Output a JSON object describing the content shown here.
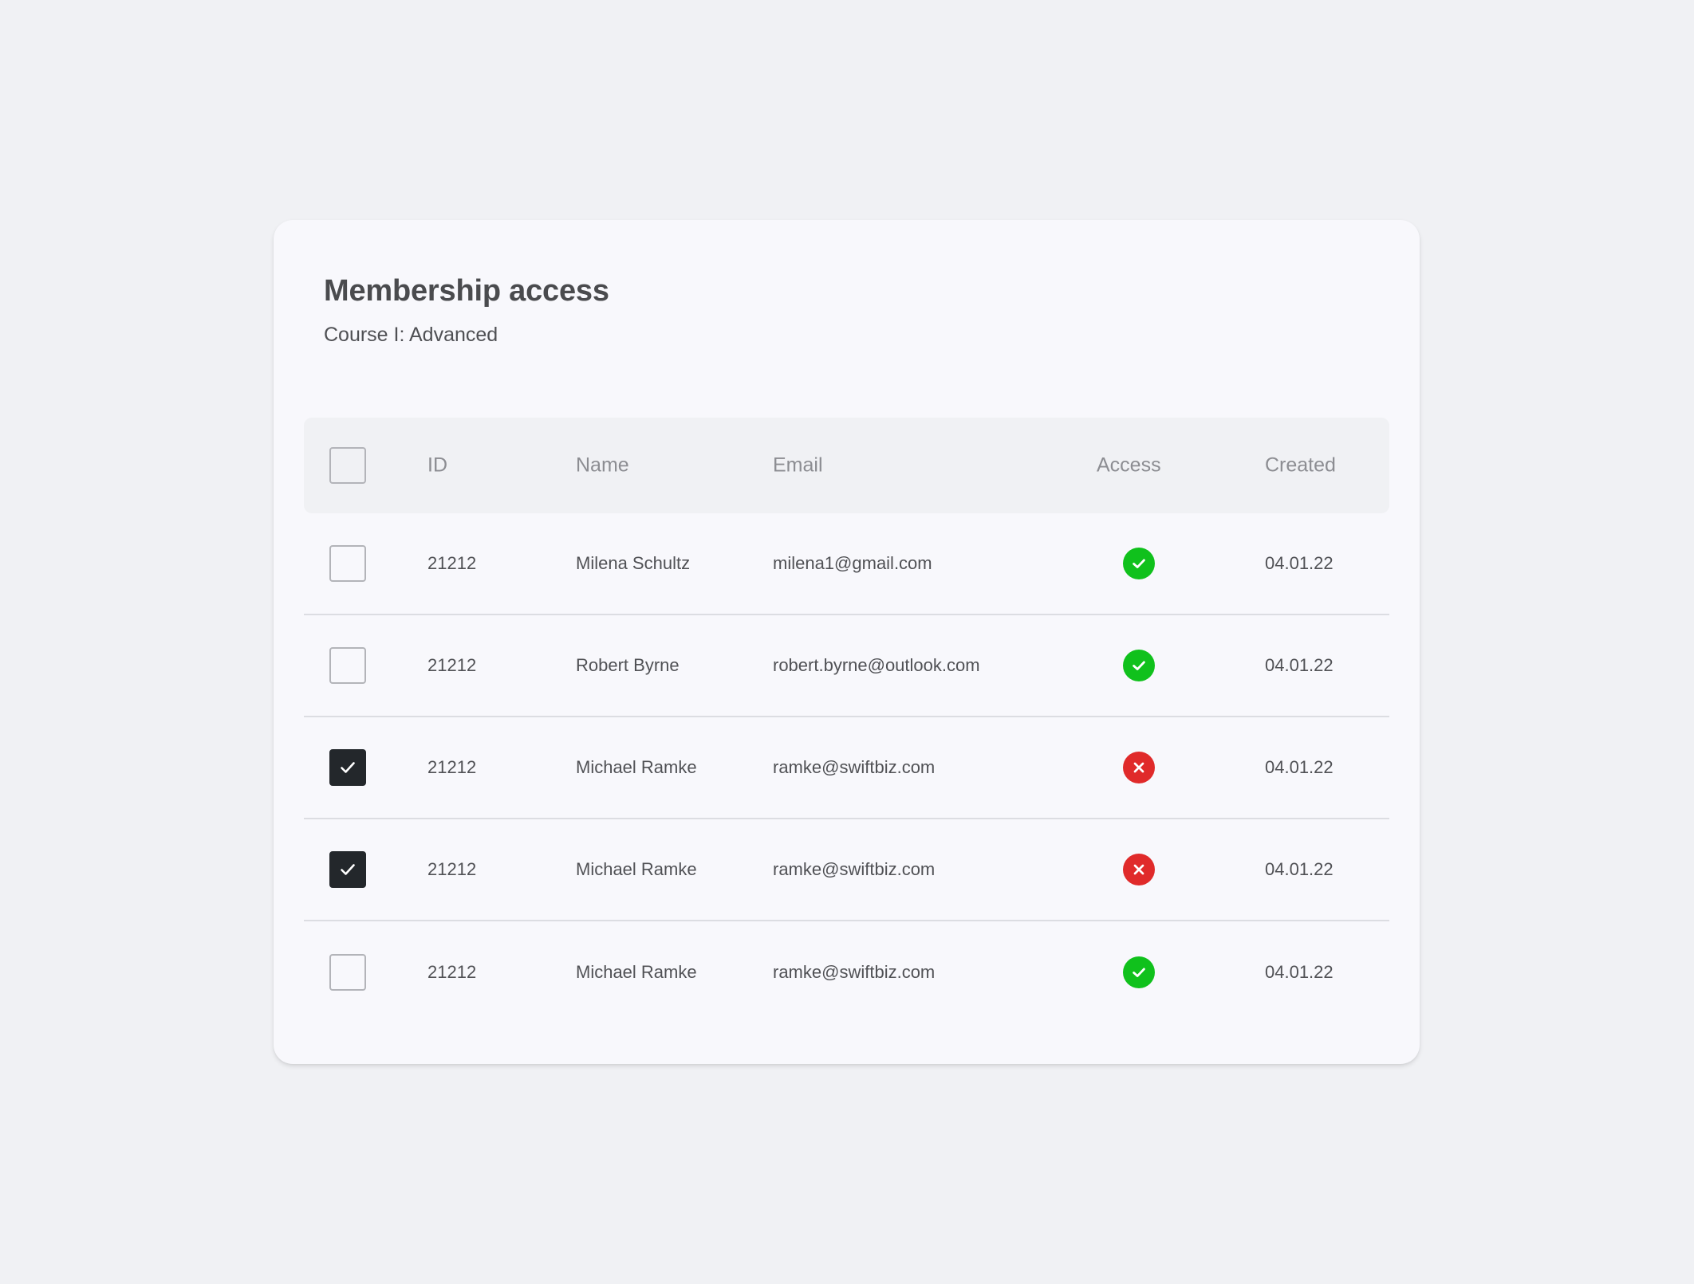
{
  "header": {
    "title": "Membership access",
    "subtitle": "Course I: Advanced"
  },
  "table": {
    "columns": {
      "id": "ID",
      "name": "Name",
      "email": "Email",
      "access": "Access",
      "created": "Created"
    },
    "select_all_checked": false,
    "rows": [
      {
        "checked": false,
        "id": "21212",
        "name": "Milena Schultz",
        "email": "milena1@gmail.com",
        "access": true,
        "created": "04.01.22"
      },
      {
        "checked": false,
        "id": "21212",
        "name": "Robert Byrne",
        "email": "robert.byrne@outlook.com",
        "access": true,
        "created": "04.01.22"
      },
      {
        "checked": true,
        "id": "21212",
        "name": "Michael Ramke",
        "email": "ramke@swiftbiz.com",
        "access": false,
        "created": "04.01.22"
      },
      {
        "checked": true,
        "id": "21212",
        "name": "Michael Ramke",
        "email": "ramke@swiftbiz.com",
        "access": false,
        "created": "04.01.22"
      },
      {
        "checked": false,
        "id": "21212",
        "name": "Michael Ramke",
        "email": "ramke@swiftbiz.com",
        "access": true,
        "created": "04.01.22"
      }
    ]
  },
  "icons": {
    "access_granted": "check-circle-icon",
    "access_denied": "x-circle-icon",
    "checkbox_checked": "checkmark-icon"
  },
  "colors": {
    "access_granted": "#10c11c",
    "access_denied": "#e02a2a",
    "checkbox_checked": "#23272b"
  }
}
